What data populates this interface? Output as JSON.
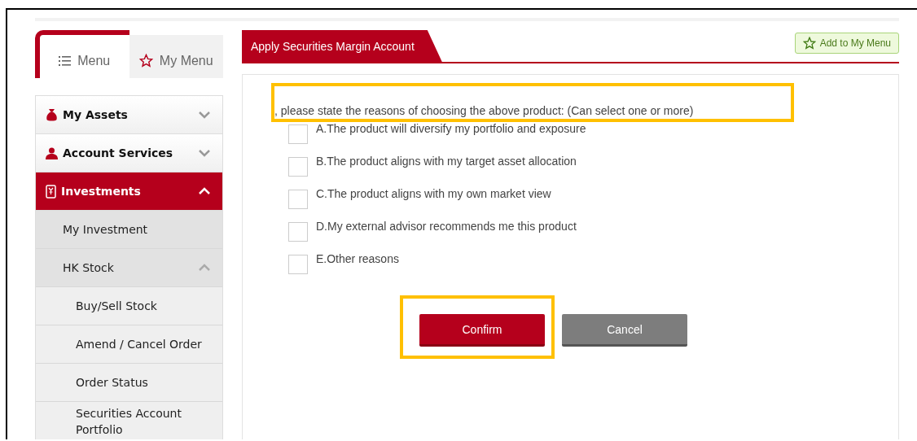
{
  "sidebar": {
    "tabs": [
      {
        "label": "Menu",
        "selected": true
      },
      {
        "label": "My Menu",
        "selected": false
      }
    ],
    "items": [
      {
        "label": "My Assets",
        "expanded": false
      },
      {
        "label": "Account Services",
        "expanded": false
      },
      {
        "label": "Investments",
        "expanded": true,
        "children": [
          {
            "label": "My Investment"
          },
          {
            "label": "HK Stock",
            "expanded": true,
            "children": [
              {
                "label": "Buy/Sell Stock"
              },
              {
                "label": "Amend / Cancel Order"
              },
              {
                "label": "Order Status"
              },
              {
                "label": "Securities Account Portfolio"
              }
            ]
          }
        ]
      }
    ]
  },
  "page": {
    "title": "Apply Securities Margin Account",
    "add_button": "Add to My Menu"
  },
  "question": {
    "text": ", please state the reasons of choosing the above product: (Can select one or more)",
    "highlighted": true
  },
  "options": [
    {
      "label": "A.The product will diversify my portfolio and exposure",
      "checked": false
    },
    {
      "label": "B.The product aligns with my target asset allocation",
      "checked": false
    },
    {
      "label": "C.The product aligns with my own market view",
      "checked": false
    },
    {
      "label": "D.My external advisor recommends me this product",
      "checked": false
    },
    {
      "label": "E.Other reasons",
      "checked": false
    }
  ],
  "buttons": [
    {
      "label": "Confirm",
      "kind": "primary",
      "highlighted": true
    },
    {
      "label": "Cancel",
      "kind": "secondary",
      "highlighted": false
    }
  ]
}
